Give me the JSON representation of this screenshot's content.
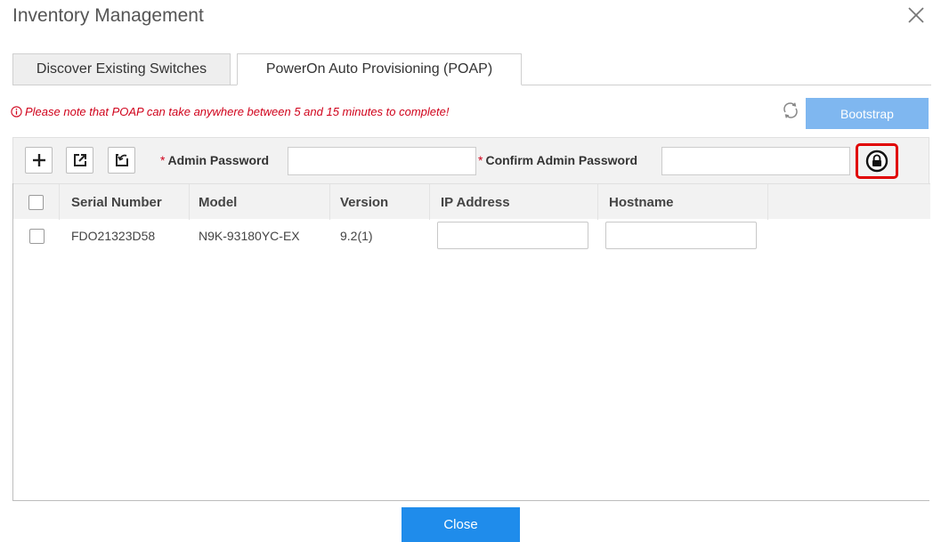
{
  "dialog": {
    "title": "Inventory Management"
  },
  "tabs": [
    {
      "label": "Discover Existing Switches",
      "active": false
    },
    {
      "label": "PowerOn Auto Provisioning (POAP)",
      "active": true
    }
  ],
  "notice": {
    "text": "Please note that POAP can take anywhere between 5 and 15 minutes to complete!",
    "color": "#d0021b",
    "icon": "info-icon"
  },
  "actions": {
    "bootstrap_label": "Bootstrap",
    "bootstrap_color": "#7fb7f0",
    "close_label": "Close",
    "close_color": "#1f8ceb"
  },
  "toolbar": {
    "admin_password_label": "Admin Password",
    "confirm_password_label": "Confirm Admin Password",
    "required_mark": "*",
    "admin_password_value": "",
    "confirm_password_value": "",
    "icons": [
      "plus-icon",
      "export-icon",
      "import-icon",
      "lock-icon"
    ],
    "highlight_color": "#e00000"
  },
  "table": {
    "columns": [
      "Serial Number",
      "Model",
      "Version",
      "IP Address",
      "Hostname"
    ],
    "rows": [
      {
        "serial": "FDO21323D58",
        "model": "N9K-93180YC-EX",
        "version": "9.2(1)",
        "ip": "",
        "hostname": ""
      }
    ]
  }
}
